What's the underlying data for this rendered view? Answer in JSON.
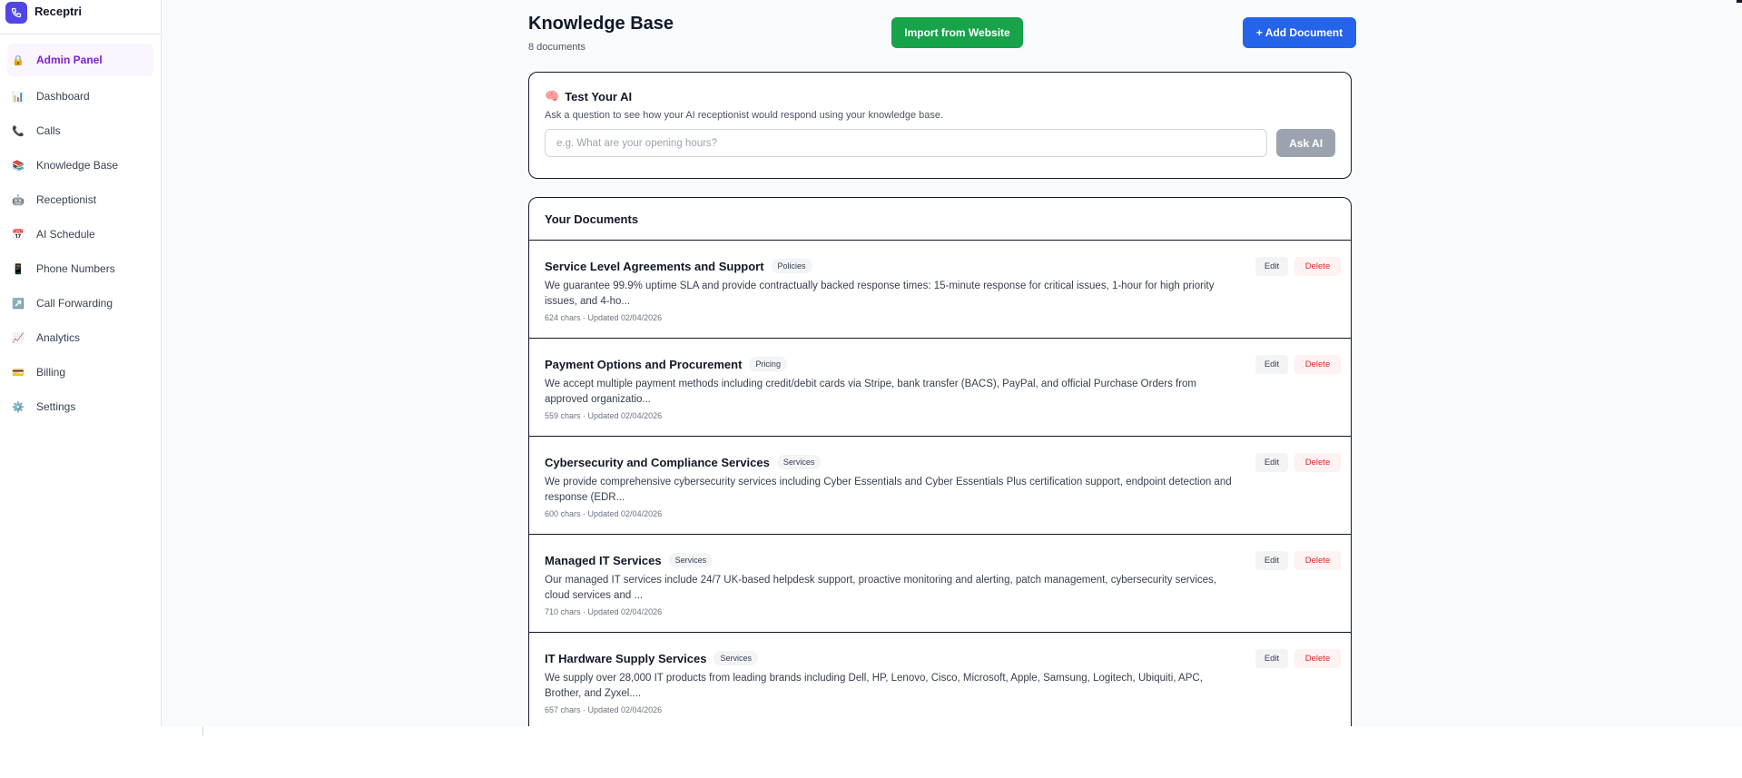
{
  "brand": {
    "name": "Receptri",
    "logo_icon": "phone-icon",
    "logo_color": "#4f46e5"
  },
  "sidebar": {
    "admin": {
      "label": "Admin Panel",
      "icon": "lock-icon"
    },
    "items": [
      {
        "label": "Dashboard",
        "icon": "bar-chart-icon"
      },
      {
        "label": "Calls",
        "icon": "phone-icon"
      },
      {
        "label": "Knowledge Base",
        "icon": "books-icon"
      },
      {
        "label": "Receptionist",
        "icon": "robot-icon"
      },
      {
        "label": "AI Schedule",
        "icon": "calendar-icon"
      },
      {
        "label": "Phone Numbers",
        "icon": "mobile-icon"
      },
      {
        "label": "Call Forwarding",
        "icon": "arrow-up-right-icon"
      },
      {
        "label": "Analytics",
        "icon": "chart-up-icon"
      },
      {
        "label": "Billing",
        "icon": "credit-card-icon"
      },
      {
        "label": "Settings",
        "icon": "gear-icon"
      }
    ]
  },
  "header": {
    "title": "Knowledge Base",
    "count": "8 documents",
    "import_label": "Import from Website",
    "add_label": "+ Add Document"
  },
  "test_ai": {
    "icon": "brain-icon",
    "title": "Test Your AI",
    "description": "Ask a question to see how your AI receptionist would respond using your knowledge base.",
    "placeholder": "e.g. What are your opening hours?",
    "value": "",
    "button": "Ask AI"
  },
  "documents": {
    "heading": "Your Documents",
    "edit_label": "Edit",
    "delete_label": "Delete",
    "items": [
      {
        "title": "Service Level Agreements and Support",
        "tag": "Policies",
        "description": "We guarantee 99.9% uptime SLA and provide contractually backed response times: 15-minute response for critical issues, 1-hour for high priority issues, and 4-ho...",
        "meta": "624 chars · Updated 02/04/2026"
      },
      {
        "title": "Payment Options and Procurement",
        "tag": "Pricing",
        "description": "We accept multiple payment methods including credit/debit cards via Stripe, bank transfer (BACS), PayPal, and official Purchase Orders from approved organizatio...",
        "meta": "559 chars · Updated 02/04/2026"
      },
      {
        "title": "Cybersecurity and Compliance Services",
        "tag": "Services",
        "description": "We provide comprehensive cybersecurity services including Cyber Essentials and Cyber Essentials Plus certification support, endpoint detection and response (EDR...",
        "meta": "600 chars · Updated 02/04/2026"
      },
      {
        "title": "Managed IT Services",
        "tag": "Services",
        "description": "Our managed IT services include 24/7 UK-based helpdesk support, proactive monitoring and alerting, patch management, cybersecurity services, cloud services and ...",
        "meta": "710 chars · Updated 02/04/2026"
      },
      {
        "title": "IT Hardware Supply Services",
        "tag": "Services",
        "description": "We supply over 28,000 IT products from leading brands including Dell, HP, Lenovo, Cisco, Microsoft, Apple, Samsung, Logitech, Ubiquiti, APC, Brother, and Zyxel....",
        "meta": "657 chars · Updated 02/04/2026"
      }
    ]
  },
  "colors": {
    "import_button": "#16a34a",
    "add_button": "#2563eb",
    "admin_accent": "#7e22ce",
    "delete_text": "#dc2626",
    "ask_button": "#9ca3af"
  }
}
